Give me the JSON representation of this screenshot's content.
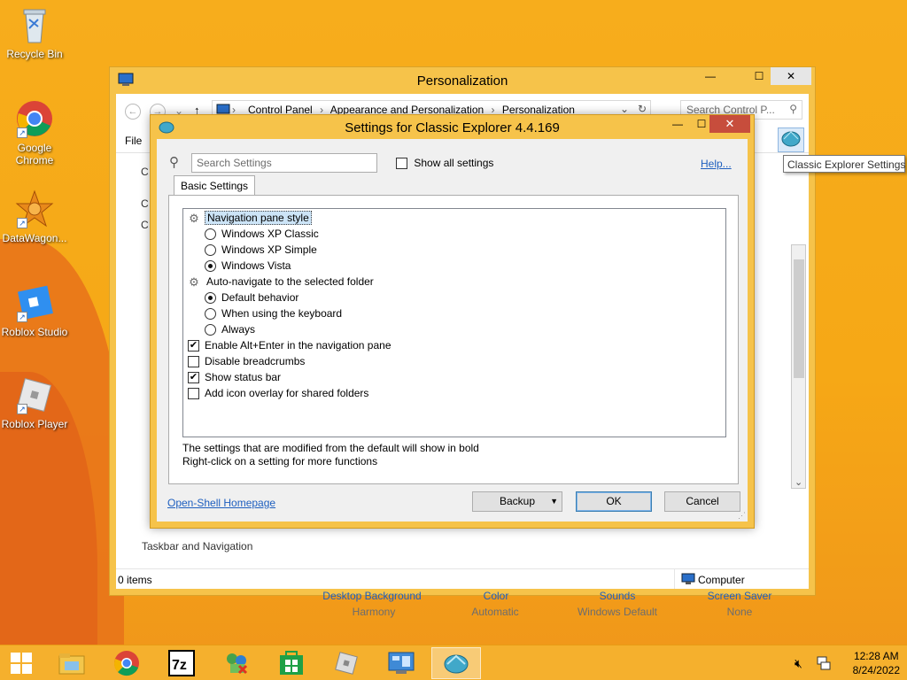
{
  "desktop": {
    "icons": [
      {
        "label": "Recycle Bin",
        "icon": "recycle-bin-icon"
      },
      {
        "label": "Google Chrome",
        "icon": "chrome-icon"
      },
      {
        "label": "DataWagon...",
        "icon": "datawagon-icon"
      },
      {
        "label": "Roblox Studio",
        "icon": "roblox-studio-icon"
      },
      {
        "label": "Roblox Player",
        "icon": "roblox-player-icon"
      }
    ]
  },
  "explorer": {
    "title": "Personalization",
    "breadcrumb": [
      "Control Panel",
      "Appearance and Personalization",
      "Personalization"
    ],
    "search_placeholder": "Search Control P...",
    "file_menu": "File",
    "tooltip": "Classic Explorer Settings",
    "taskbar_nav": "Taskbar and Navigation",
    "theme_items": [
      {
        "label": "Desktop Background",
        "value": "Harmony"
      },
      {
        "label": "Color",
        "value": "Automatic"
      },
      {
        "label": "Sounds",
        "value": "Windows Default"
      },
      {
        "label": "Screen Saver",
        "value": "None"
      }
    ],
    "status_left": "0 items",
    "status_right": "Computer"
  },
  "dialog": {
    "title": "Settings for Classic Explorer 4.4.169",
    "search_placeholder": "Search Settings",
    "show_all_label": "Show all settings",
    "help_link": "Help...",
    "tab_label": "Basic Settings",
    "settings": [
      {
        "type": "group",
        "label": "Navigation pane style",
        "selected": true
      },
      {
        "type": "radio",
        "label": "Windows XP Classic",
        "checked": false
      },
      {
        "type": "radio",
        "label": "Windows XP Simple",
        "checked": false
      },
      {
        "type": "radio",
        "label": "Windows Vista",
        "checked": true
      },
      {
        "type": "group",
        "label": "Auto-navigate to the selected folder"
      },
      {
        "type": "radio",
        "label": "Default behavior",
        "checked": true
      },
      {
        "type": "radio",
        "label": "When using the keyboard",
        "checked": false
      },
      {
        "type": "radio",
        "label": "Always",
        "checked": false
      },
      {
        "type": "check",
        "label": "Enable Alt+Enter in the navigation pane",
        "checked": true
      },
      {
        "type": "check",
        "label": "Disable breadcrumbs",
        "checked": false
      },
      {
        "type": "check",
        "label": "Show status bar",
        "checked": true
      },
      {
        "type": "check",
        "label": "Add icon overlay for shared folders",
        "checked": false
      }
    ],
    "note_line1": "The settings that are modified from the default will show in bold",
    "note_line2": "Right-click on a setting for more functions",
    "homepage_link": "Open-Shell Homepage",
    "backup_label": "Backup",
    "ok_label": "OK",
    "cancel_label": "Cancel"
  },
  "taskbar": {
    "time": "12:28 AM",
    "date": "8/24/2022",
    "apps": [
      "file-explorer-icon",
      "chrome-icon",
      "7zip-icon",
      "network-icon",
      "store-icon",
      "roblox-icon",
      "control-panel-icon",
      "classic-shell-icon"
    ]
  }
}
